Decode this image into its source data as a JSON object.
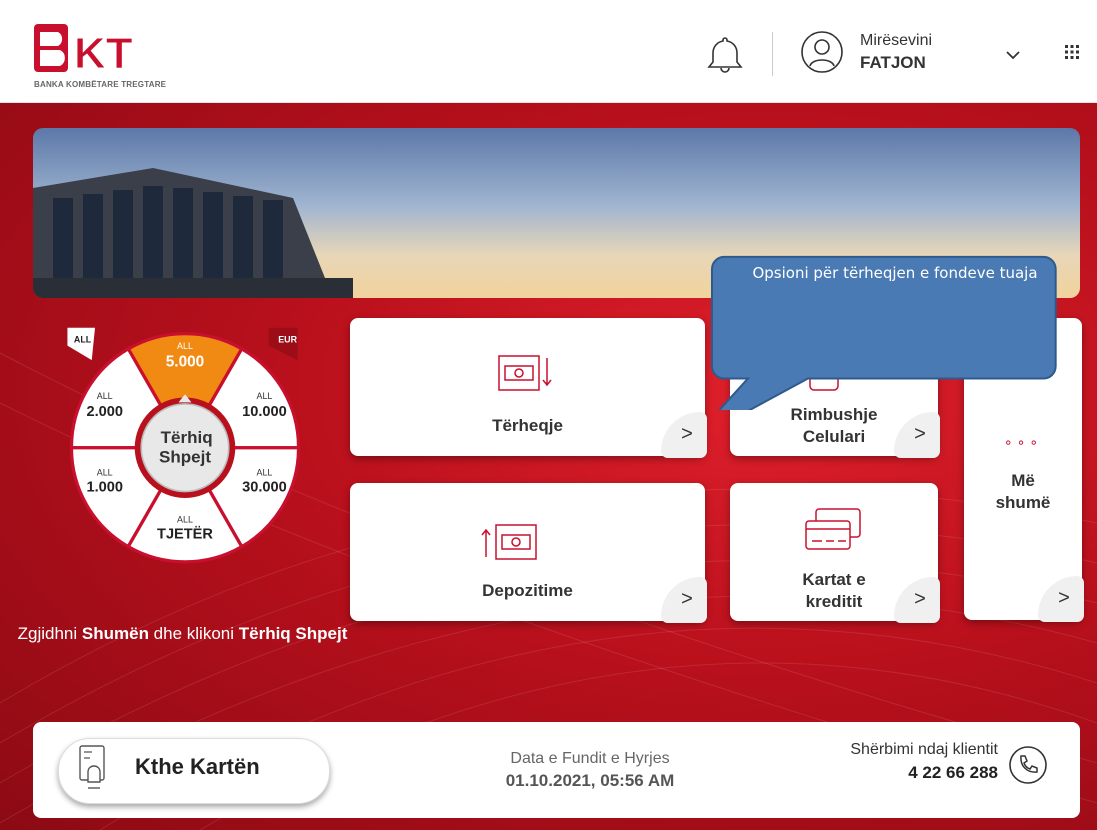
{
  "header": {
    "logo_text": "BKT",
    "bank_name": "BANKA KOMBËTARE TREGTARE",
    "welcome": "Mirësevini",
    "username": "FATJON",
    "icons": [
      "bell-icon",
      "user-icon",
      "chevron-down-icon",
      "apps-grid-icon"
    ]
  },
  "fastcash": {
    "left_badge": "ALL",
    "right_badge": "EUR",
    "currency": "ALL",
    "amounts": {
      "top": "5.000",
      "upper_left": "2.000",
      "upper_right": "10.000",
      "lower_left": "1.000",
      "lower_right": "30.000",
      "bottom": "TJETËR"
    },
    "center_line1": "Tërhiq",
    "center_line2": "Shpejt",
    "hint_part1": "Zgjidhni ",
    "hint_bold1": "Shumën",
    "hint_part2": " dhe klikoni ",
    "hint_bold2": "Tërhiq Shpejt"
  },
  "tiles": {
    "withdraw": "Tërheqje",
    "deposit": "Depozitime",
    "topup_line1": "Rimbushje",
    "topup_line2": "Celulari",
    "cards_line1": "Kartat e",
    "cards_line2": "kreditit",
    "more_line1": "Më",
    "more_line2": "shumë",
    "arrow": ">"
  },
  "callout": {
    "text": "Opsioni për tërheqjen e fondeve tuaja"
  },
  "footer": {
    "return_card": "Kthe Kartën",
    "last_login_label": "Data e Fundit e Hyrjes",
    "last_login_value": "01.10.2021, 05:56 AM",
    "service_label": "Shërbimi ndaj klientit",
    "service_phone": "4 22 66 288"
  },
  "colors": {
    "brand_red": "#c8102e",
    "accent_orange": "#f08a12",
    "callout_blue": "#4a7ab4"
  }
}
